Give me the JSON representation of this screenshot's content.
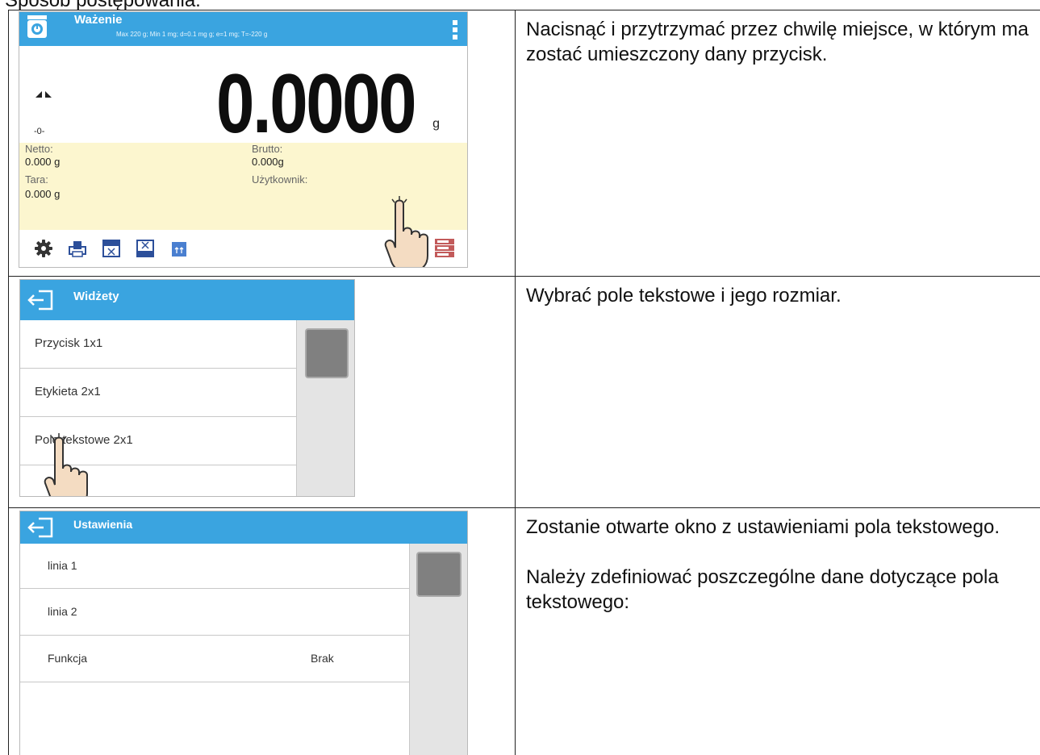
{
  "top_text": "Sposób postępowania:",
  "rows": [
    {
      "description": [
        "Nacisnąć i przytrzymać przez chwilę miejsce, w którym ma zostać umieszczony dany przycisk."
      ]
    },
    {
      "description": [
        "Wybrać pole tekstowe i jego rozmiar."
      ]
    },
    {
      "description": [
        "Zostanie otwarte okno z ustawieniami pola tekstowego.",
        "Należy zdefiniować poszczególne dane dotyczące pola tekstowego:"
      ]
    }
  ],
  "weighing_screen": {
    "title": "Ważenie",
    "subtitle": "Max 220 g; Min 1 mg; d=0.1 mg g; e=1 mg; T=-220 g",
    "value": "0.0000",
    "unit": "g",
    "zero_indicator": "-0-",
    "info": {
      "netto_label": "Netto:",
      "netto_value": "0.000 g",
      "brutto_label": "Brutto:",
      "brutto_value": "0.000g",
      "tara_label": "Tara:",
      "tara_value": "0.000 g",
      "user_label": "Użytkownik:"
    },
    "toolbar_icons": [
      "gear-icon",
      "printer-icon",
      "tare-icon",
      "tare-set-icon",
      "header-icon",
      "widget-stack-icon"
    ]
  },
  "widgets_screen": {
    "title": "Widżety",
    "items": [
      "Przycisk 1x1",
      "Etykieta 2x1",
      "Pole tekstowe 2x1"
    ]
  },
  "settings_screen": {
    "title": "Ustawienia",
    "items": [
      {
        "label": "linia 1",
        "value": ""
      },
      {
        "label": "linia 2",
        "value": ""
      },
      {
        "label": "Funkcja",
        "value": "Brak"
      }
    ]
  },
  "colors": {
    "header_blue": "#3aa4e0",
    "info_yellow": "#fcf6cf",
    "scroll_thumb": "#808080"
  }
}
